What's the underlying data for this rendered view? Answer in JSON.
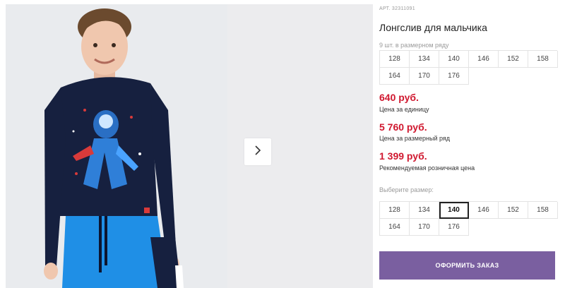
{
  "product": {
    "article": "АРТ. 32311091",
    "title": "Лонгслив для мальчика",
    "series_hint": "9 шт. в размерном ряду"
  },
  "series_sizes": [
    "128",
    "134",
    "140",
    "146",
    "152",
    "158",
    "164",
    "170",
    "176"
  ],
  "prices": {
    "unit_price": "640 руб.",
    "unit_label": "Цена за единицу",
    "series_price": "5 760 руб.",
    "series_label": "Цена за размерный ряд",
    "retail_price": "1 399 руб.",
    "retail_label": "Рекомендуемая розничная цена"
  },
  "size_select": {
    "label": "Выберите размер:",
    "sizes": [
      "128",
      "134",
      "140",
      "146",
      "152",
      "158",
      "164",
      "170",
      "176"
    ],
    "selected": "140"
  },
  "order_button": "ОФОРМИТЬ ЗАКАЗ",
  "colors": {
    "price": "#d0182f",
    "button": "#7a5fa0",
    "shirt": "#16203f",
    "pants": "#1f8fe6"
  },
  "icons": {
    "next": "chevron-right-icon"
  }
}
